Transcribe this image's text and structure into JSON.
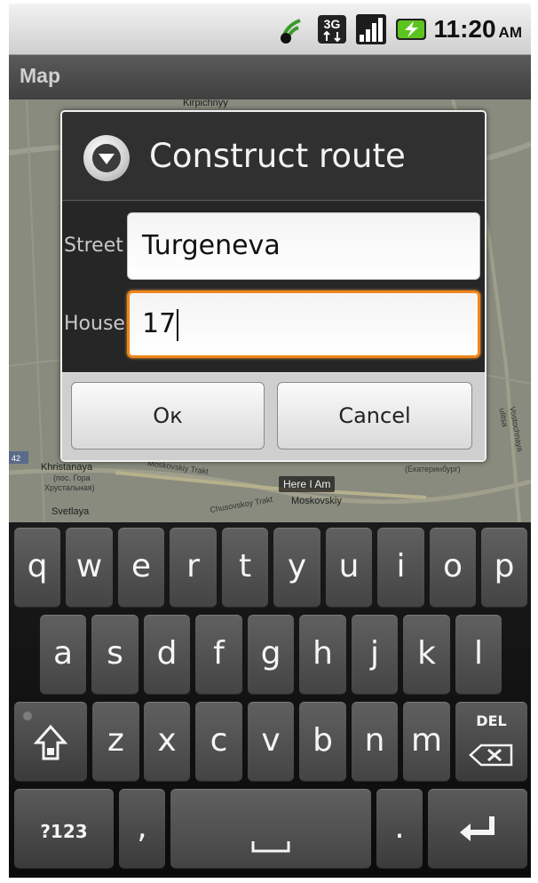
{
  "status_bar": {
    "time": "11:20",
    "ampm": "AM",
    "network_type": "3G",
    "icons": [
      "gps-signal-icon",
      "3g-data-icon",
      "signal-bars-icon",
      "battery-charging-icon"
    ]
  },
  "app": {
    "title": "Map"
  },
  "map": {
    "labels": [
      "Kirpichnyy",
      "Khristanaya",
      "(пос. Гора",
      "Хрустальная)",
      "Moskovskiy Trakt",
      "Chusovskoy Trakt",
      "Moskovskiy",
      "Svetlaya",
      "(Екатеринбург)",
      "Vostochnaya ulitsa",
      "42"
    ],
    "marker_label": "Here I Am"
  },
  "dialog": {
    "title": "Construct route",
    "street_label": "Street",
    "street_value": "Turgeneva",
    "house_label": "House",
    "house_value": "17",
    "ok_label": "Ок",
    "cancel_label": "Cancel"
  },
  "keyboard": {
    "row1": [
      "q",
      "w",
      "e",
      "r",
      "t",
      "y",
      "u",
      "i",
      "o",
      "p"
    ],
    "row2": [
      "a",
      "s",
      "d",
      "f",
      "g",
      "h",
      "j",
      "k",
      "l"
    ],
    "row3": [
      "z",
      "x",
      "c",
      "v",
      "b",
      "n",
      "m"
    ],
    "symbols_label": "?123",
    "comma_label": ",",
    "period_label": ".",
    "delete_label": "DEL"
  }
}
